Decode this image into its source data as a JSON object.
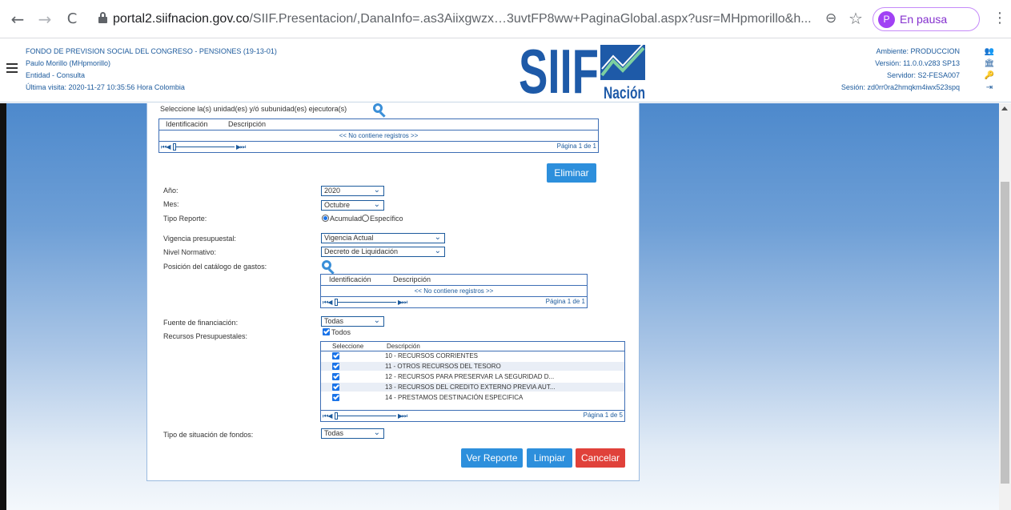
{
  "browser": {
    "back": "←",
    "forward": "→",
    "reload": "C",
    "url_host": "portal2.siifnacion.gov.co",
    "url_path": "/SIIF.Presentacion/,DanaInfo=.as3Aiixgwzx…3uvtFP8ww+PaginaGlobal.aspx?usr=MHpmorillo&h...",
    "profile_initial": "P",
    "profile_label": "En pausa"
  },
  "header": {
    "entity": "FONDO DE PREVISION SOCIAL DEL CONGRESO - PENSIONES (19-13-01)",
    "user": "Paulo Morillo (MHpmorillo)",
    "role": "Entidad - Consulta",
    "last_visit": "Última visita: 2020-11-27 10:35:56 Hora Colombia",
    "logo_main": "SIIF",
    "logo_sub": "Nación",
    "environment": "Ambiente: PRODUCCION",
    "version": "Versión: 11.0.0.v283 SP13",
    "server": "Servidor: S2-FESA007",
    "session": "Sesión: zd0rr0ra2hmqkm4iwx523spq"
  },
  "form": {
    "unit_label": "Seleccione la(s) unidad(es) y/ó subunidad(es) ejecutora(s)",
    "grid1": {
      "col_id": "Identificación",
      "col_desc": "Descripción",
      "empty": "<< No contiene registros >>",
      "page": "Página 1 de 1"
    },
    "delete_button": "Eliminar",
    "year_label": "Año:",
    "year_value": "2020",
    "month_label": "Mes:",
    "month_value": "Octubre",
    "report_type_label": "Tipo Reporte:",
    "report_type_opt1": "Acumulado",
    "report_type_opt2": "Específico",
    "vigencia_label": "Vigencia presupuestal:",
    "vigencia_value": "Vigencia Actual",
    "nivel_label": "Nivel Normativo:",
    "nivel_value": "Decreto de Liquidación",
    "catalog_label": "Posición del catálogo de gastos:",
    "grid2": {
      "col_id": "Identificación",
      "col_desc": "Descripción",
      "empty": "<< No contiene registros >>",
      "page": "Página 1 de 1"
    },
    "fuente_label": "Fuente de financiación:",
    "fuente_value": "Todas",
    "recursos_label": "Recursos Presupuestales:",
    "todos_label": "Todos",
    "grid3": {
      "col_sel": "Seleccione",
      "col_desc": "Descripción",
      "rows": [
        "10 - RECURSOS CORRIENTES",
        "11 - OTROS RECURSOS DEL TESORO",
        "12 - RECURSOS PARA PRESERVAR LA SEGURIDAD D...",
        "13 - RECURSOS DEL CREDITO EXTERNO PREVIA AUT...",
        "14 - PRESTAMOS DESTINACIÓN ESPECIFICA"
      ],
      "page": "Página 1 de 5"
    },
    "situacion_label": "Tipo de situación de fondos:",
    "situacion_value": "Todas",
    "ver_reporte_button": "Ver Reporte",
    "limpiar_button": "Limpiar",
    "cancelar_button": "Cancelar"
  },
  "colors": {
    "primary_blue": "#2d8fdc",
    "danger_red": "#e0413a",
    "link_blue": "#1c5a9c"
  }
}
